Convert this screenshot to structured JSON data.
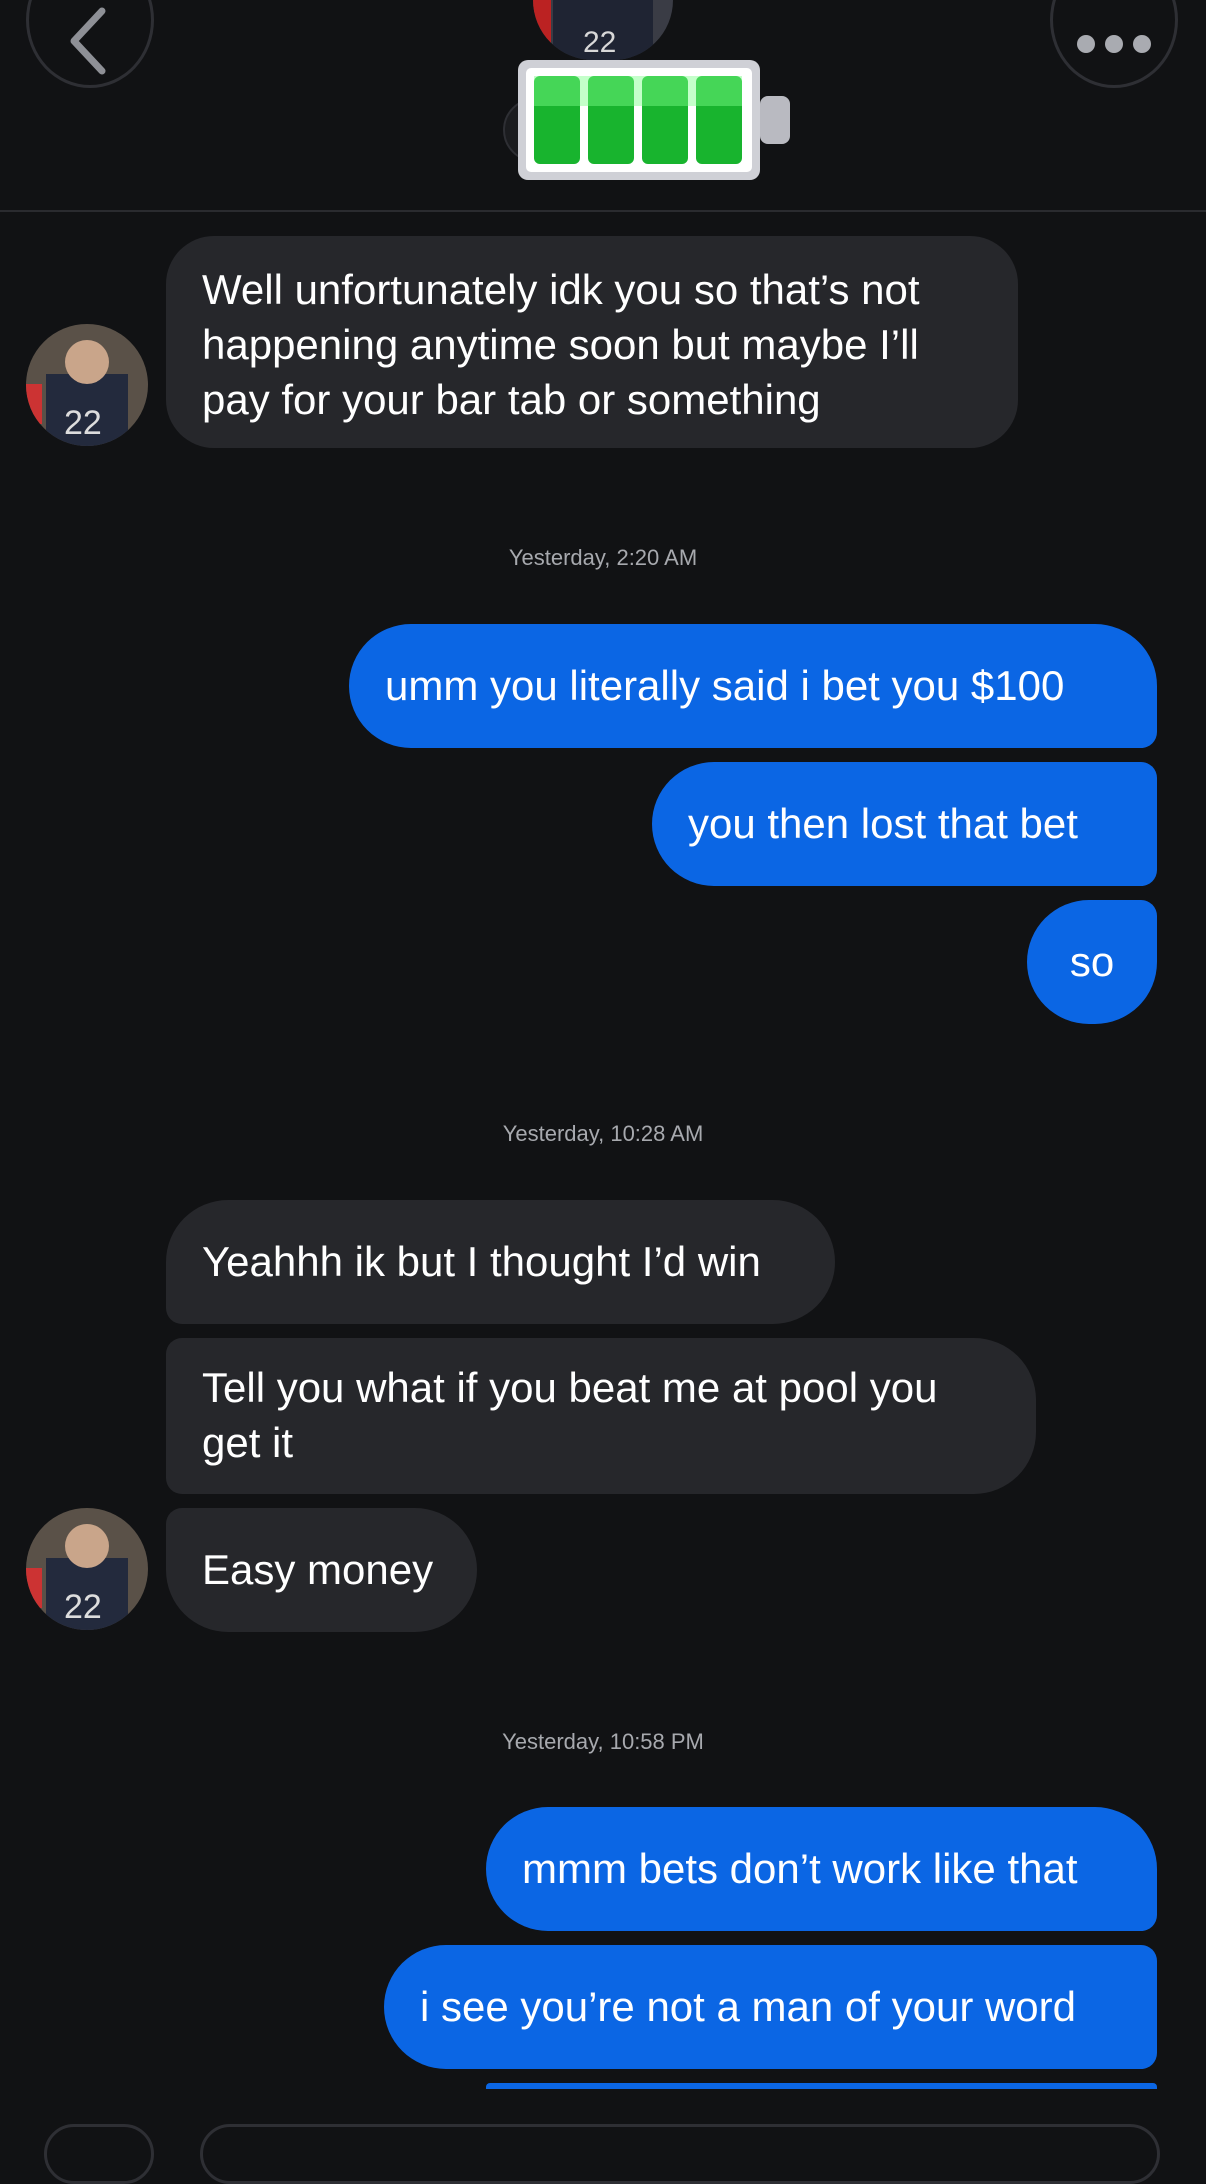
{
  "header": {
    "back_icon": "chevron-left-icon",
    "more_icon": "more-dots-icon",
    "battery_icon": "battery-full-icon",
    "accent": "#0b66e4"
  },
  "messages": [
    {
      "dir": "in",
      "lines": [
        "Well unfortunately idk you so that’s not",
        "happening anytime soon but maybe I’ll",
        "pay for your bar tab or something"
      ]
    },
    {
      "timestamp": "Yesterday, 2:20 AM"
    },
    {
      "dir": "out",
      "lines": [
        "umm you literally said i bet you $100"
      ]
    },
    {
      "dir": "out",
      "lines": [
        "you then lost that bet"
      ]
    },
    {
      "dir": "out",
      "lines": [
        "so"
      ]
    },
    {
      "timestamp": "Yesterday, 10:28 AM"
    },
    {
      "dir": "in",
      "lines": [
        "Yeahhh ik but I thought I’d win"
      ]
    },
    {
      "dir": "in",
      "lines": [
        "Tell you what if you beat me at pool you",
        "get it"
      ]
    },
    {
      "dir": "in",
      "lines": [
        "Easy money"
      ]
    },
    {
      "timestamp": "Yesterday, 10:58 PM"
    },
    {
      "dir": "out",
      "lines": [
        "mmm bets don’t work like that"
      ]
    },
    {
      "dir": "out",
      "lines": [
        "i see you’re not a man of your word"
      ]
    }
  ]
}
